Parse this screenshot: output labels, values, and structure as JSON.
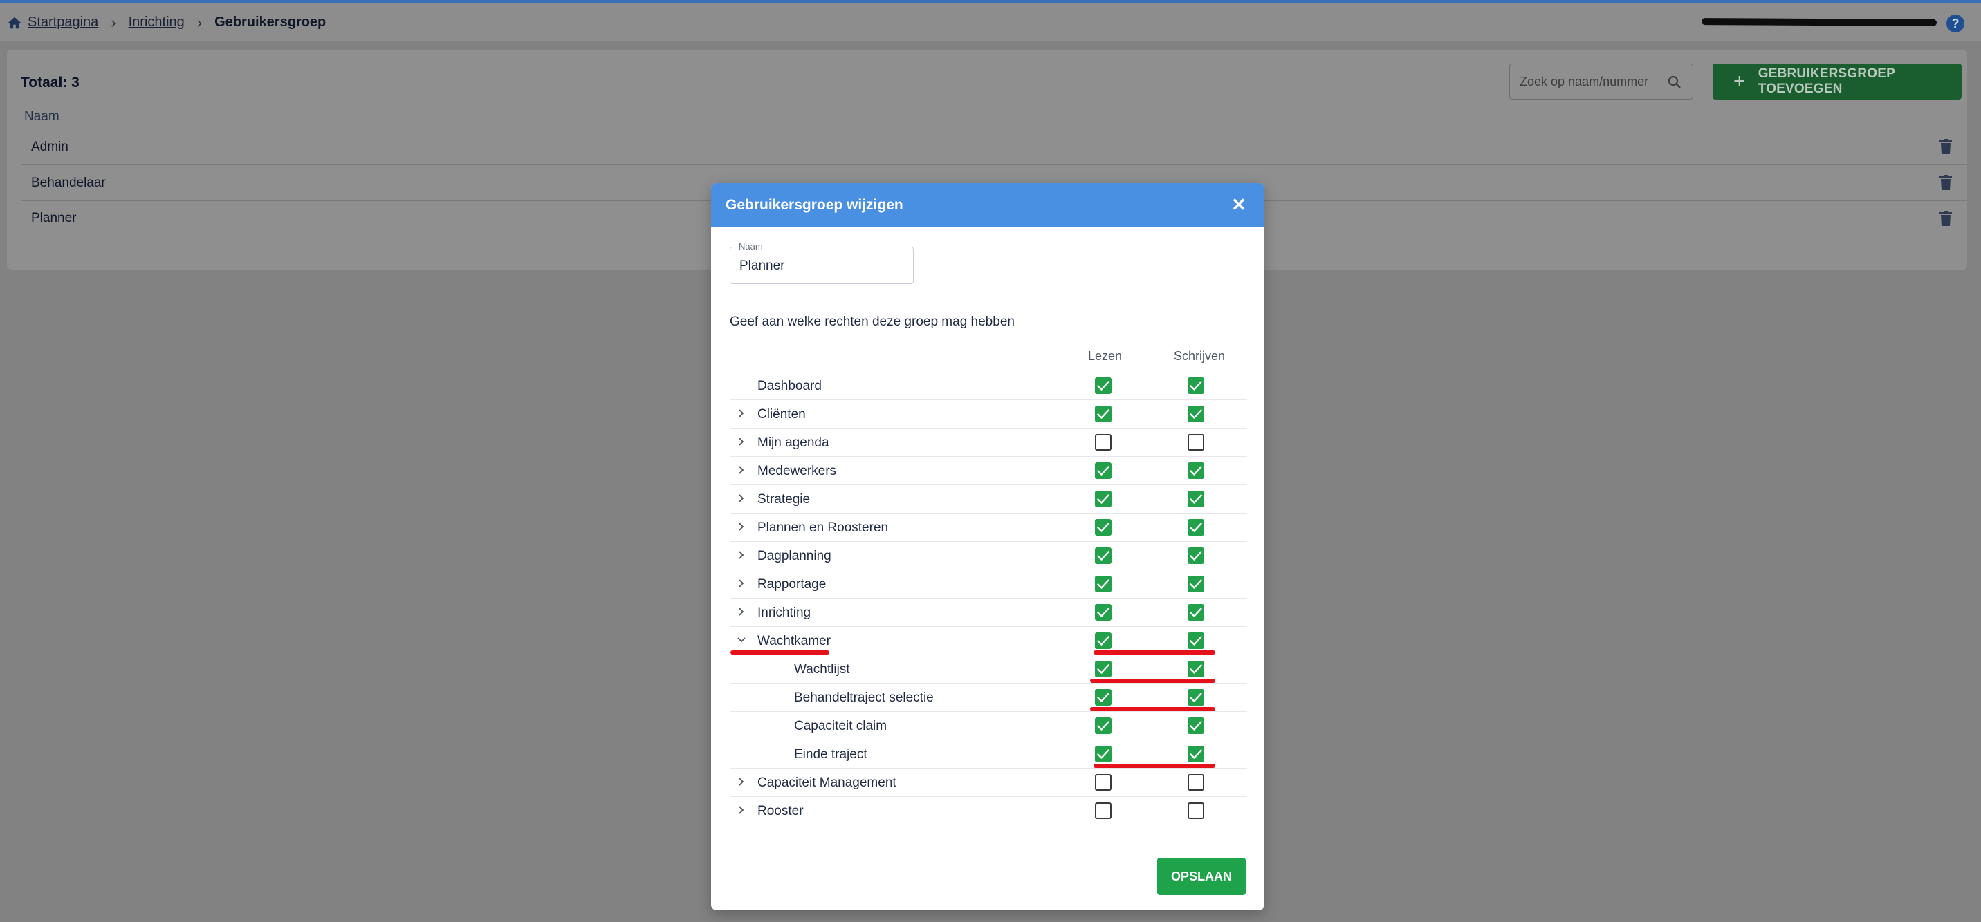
{
  "breadcrumb": {
    "home": "Startpagina",
    "section": "Inrichting",
    "current": "Gebruikersgroep"
  },
  "list": {
    "total": "Totaal: 3",
    "search_placeholder": "Zoek op naam/nummer",
    "add_button": "GEBRUIKERSGROEP TOEVOEGEN",
    "column_name": "Naam",
    "rows": [
      "Admin",
      "Behandelaar",
      "Planner"
    ]
  },
  "modal": {
    "title": "Gebruikersgroep wijzigen",
    "name_label": "Naam",
    "name_value": "Planner",
    "instruction": "Geef aan welke rechten deze groep mag hebben",
    "col_read": "Lezen",
    "col_write": "Schrijven",
    "save_button": "OPSLAAN",
    "permissions": [
      {
        "label": "Dashboard",
        "level": 0,
        "chevron": "none",
        "read": true,
        "write": true
      },
      {
        "label": "Cliënten",
        "level": 0,
        "chevron": "right",
        "read": true,
        "write": true
      },
      {
        "label": "Mijn agenda",
        "level": 0,
        "chevron": "right",
        "read": false,
        "write": false
      },
      {
        "label": "Medewerkers",
        "level": 0,
        "chevron": "right",
        "read": true,
        "write": true
      },
      {
        "label": "Strategie",
        "level": 0,
        "chevron": "right",
        "read": true,
        "write": true
      },
      {
        "label": "Plannen en Roosteren",
        "level": 0,
        "chevron": "right",
        "read": true,
        "write": true
      },
      {
        "label": "Dagplanning",
        "level": 0,
        "chevron": "right",
        "read": true,
        "write": true
      },
      {
        "label": "Rapportage",
        "level": 0,
        "chevron": "right",
        "read": true,
        "write": true
      },
      {
        "label": "Inrichting",
        "level": 0,
        "chevron": "right",
        "read": true,
        "write": true
      },
      {
        "label": "Wachtkamer",
        "level": 0,
        "chevron": "down",
        "read": true,
        "write": true
      },
      {
        "label": "Wachtlijst",
        "level": 1,
        "chevron": "none",
        "read": true,
        "write": true
      },
      {
        "label": "Behandeltraject selectie",
        "level": 1,
        "chevron": "none",
        "read": true,
        "write": true
      },
      {
        "label": "Capaciteit claim",
        "level": 1,
        "chevron": "none",
        "read": true,
        "write": true
      },
      {
        "label": "Einde traject",
        "level": 1,
        "chevron": "none",
        "read": true,
        "write": true
      },
      {
        "label": "Capaciteit Management",
        "level": 0,
        "chevron": "right",
        "read": false,
        "write": false
      },
      {
        "label": "Rooster",
        "level": 0,
        "chevron": "right",
        "read": false,
        "write": false
      }
    ]
  },
  "colors": {
    "accent_blue": "#4a90e2",
    "check_green": "#22a04a",
    "annotation_red": "#e5121b"
  },
  "icons": [
    "home-icon",
    "chevron-right-icon",
    "help-icon",
    "search-icon",
    "plus-icon",
    "trash-icon",
    "close-icon",
    "chevron-down-icon",
    "checkmark-icon"
  ]
}
